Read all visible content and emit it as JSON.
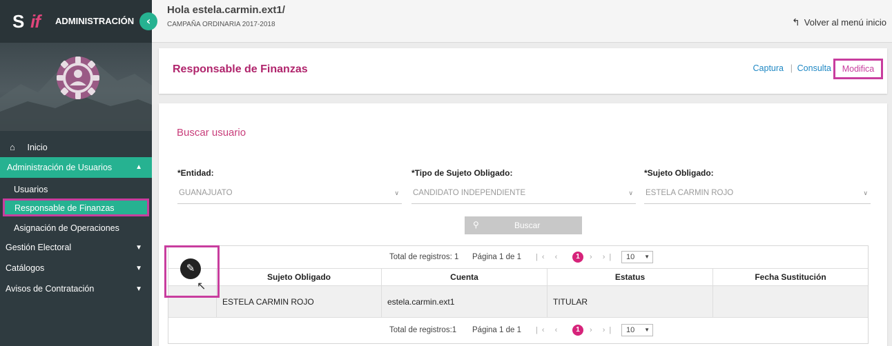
{
  "brand": {
    "logo_s": "S",
    "logo_if": "if",
    "title": "ADMINISTRACIÓN",
    "collapse_icon": "chevron-left-icon"
  },
  "header": {
    "greeting": "Hola estela.carmin.ext1/",
    "campaign": "CAMPAÑA ORDINARIA 2017-2018",
    "back_label": "Volver al menú inicio"
  },
  "sidebar": {
    "home": "Inicio",
    "admin_section": "Administración de Usuarios",
    "sub_items": [
      "Usuarios",
      "Responsable de Finanzas",
      "Asignación de Operaciones"
    ],
    "sections": [
      "Gestión Electoral",
      "Catálogos",
      "Avisos de Contratación"
    ]
  },
  "page": {
    "title": "Responsable de Finanzas",
    "tabs": [
      "Captura",
      "Consulta",
      "Modifica"
    ],
    "active_tab": "Modifica",
    "tab_separator": "|"
  },
  "search": {
    "title": "Buscar usuario",
    "fields": [
      {
        "label": "*Entidad:",
        "value": "GUANAJUATO"
      },
      {
        "label": "*Tipo de Sujeto Obligado:",
        "value": "CANDIDATO INDEPENDIENTE"
      },
      {
        "label": "*Sujeto Obligado:",
        "value": "ESTELA CARMIN ROJO"
      }
    ],
    "button": "Buscar"
  },
  "table": {
    "pager_top": {
      "total": "Total de registros: 1",
      "page": "Página 1 de 1",
      "current": "1",
      "page_size": "10"
    },
    "pager_bottom": {
      "total": "Total de registros:1",
      "page": "Página 1 de 1",
      "current": "1",
      "page_size": "10"
    },
    "columns": [
      "Sujeto Obligado",
      "Cuenta",
      "Estatus",
      "Fecha Sustitución"
    ],
    "rows": [
      {
        "sujeto": "ESTELA CARMIN ROJO",
        "cuenta": "estela.carmin.ext1",
        "estatus": "TITULAR",
        "fecha": ""
      }
    ]
  },
  "colors": {
    "accent_green": "#26b291",
    "brand_pink": "#b0246c",
    "highlight_magenta": "#c83d9e",
    "sidebar_bg": "#2f3b40",
    "link_blue": "#1f88c4"
  }
}
